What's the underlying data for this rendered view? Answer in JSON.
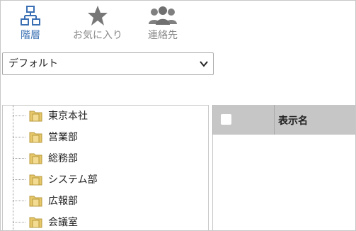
{
  "tabs": [
    {
      "label": "階層",
      "icon": "hierarchy-icon",
      "active": true
    },
    {
      "label": "お気に入り",
      "icon": "star-icon",
      "active": false
    },
    {
      "label": "連絡先",
      "icon": "contacts-icon",
      "active": false
    }
  ],
  "view_select": {
    "value": "デフォルト"
  },
  "tree": {
    "items": [
      {
        "label": "東京本社",
        "icon": "folder-icon"
      },
      {
        "label": "営業部",
        "icon": "folder-icon"
      },
      {
        "label": "総務部",
        "icon": "folder-icon"
      },
      {
        "label": "システム部",
        "icon": "folder-icon"
      },
      {
        "label": "広報部",
        "icon": "folder-icon"
      },
      {
        "label": "会議室",
        "icon": "folder-icon"
      }
    ]
  },
  "grid": {
    "columns": [
      "表示名"
    ],
    "select_all_checked": false
  },
  "colors": {
    "accent": "#3a6fb3",
    "inactive_icon": "#888888",
    "grid_header_bg": "#c6c6c6"
  }
}
